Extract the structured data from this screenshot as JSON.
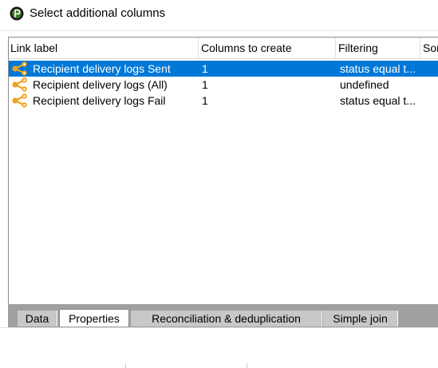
{
  "window": {
    "title": "Select additional columns",
    "icon": "app-logo-icon"
  },
  "grid": {
    "columns": [
      "Link label",
      "Columns to create",
      "Filtering",
      "Sor"
    ],
    "rows": [
      {
        "label": "Recipient delivery logs Sent",
        "columns": "1",
        "filtering": "status equal t...",
        "selected": true,
        "icon": "link-icon"
      },
      {
        "label": "Recipient delivery logs (All)",
        "columns": "1",
        "filtering": "undefined",
        "selected": false,
        "icon": "link-icon"
      },
      {
        "label": "Recipient delivery logs Fail",
        "columns": "1",
        "filtering": "status equal t...",
        "selected": false,
        "icon": "link-icon"
      }
    ]
  },
  "tabs": [
    {
      "label": "Data",
      "active": false
    },
    {
      "label": "Properties",
      "active": true
    },
    {
      "label": "Reconciliation & deduplication",
      "active": false
    },
    {
      "label": "Simple join",
      "active": false
    }
  ],
  "colors": {
    "selection": "#0078d7",
    "link_icon": "#f0a020",
    "tab_background": "#a0a0a0"
  }
}
